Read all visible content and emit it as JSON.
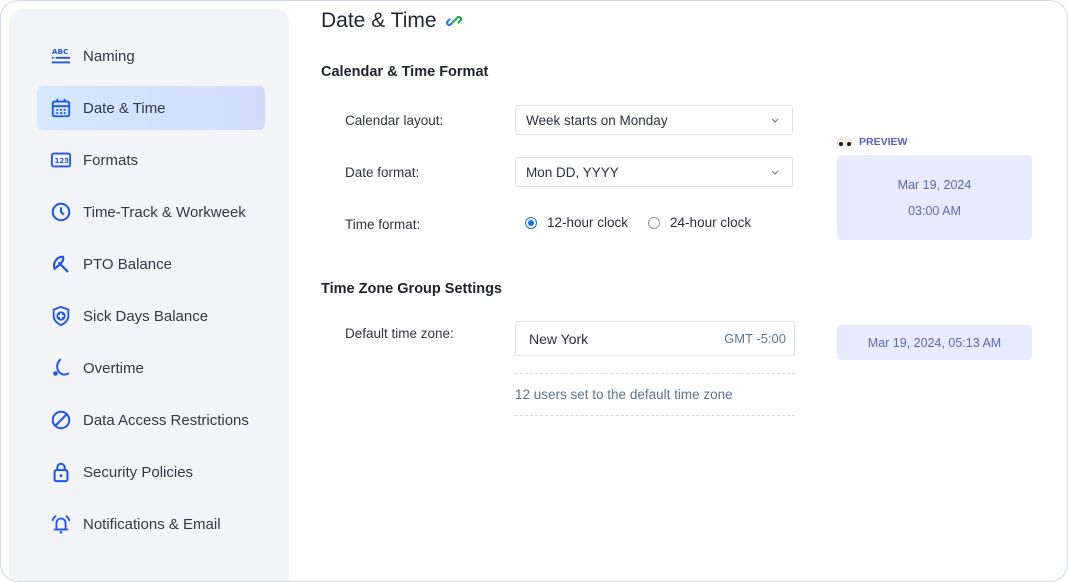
{
  "sidebar": {
    "items": [
      {
        "label": "Naming",
        "icon": "abc-list-icon",
        "active": false
      },
      {
        "label": "Date & Time",
        "icon": "calendar-icon",
        "active": true
      },
      {
        "label": "Formats",
        "icon": "numbers-123-icon",
        "active": false
      },
      {
        "label": "Time-Track & Workweek",
        "icon": "clock-icon",
        "active": false
      },
      {
        "label": "PTO Balance",
        "icon": "beach-umbrella-icon",
        "active": false
      },
      {
        "label": "Sick Days Balance",
        "icon": "shield-plus-icon",
        "active": false
      },
      {
        "label": "Overtime",
        "icon": "moon-icon",
        "active": false
      },
      {
        "label": "Data Access Restrictions",
        "icon": "prohibited-icon",
        "active": false
      },
      {
        "label": "Security Policies",
        "icon": "lock-icon",
        "active": false
      },
      {
        "label": "Notifications & Email",
        "icon": "bell-ringing-icon",
        "active": false
      }
    ]
  },
  "main": {
    "title": "Date & Time",
    "title_icon": "link-icon",
    "calendar_section": {
      "title": "Calendar & Time Format",
      "calendar_layout_label": "Calendar layout:",
      "calendar_layout_value": "Week starts on Monday",
      "date_format_label": "Date format:",
      "date_format_value": "Mon DD, YYYY",
      "time_format_label": "Time format:",
      "time_options": [
        {
          "label": "12-hour clock",
          "checked": true
        },
        {
          "label": "24-hour clock",
          "checked": false
        }
      ]
    },
    "preview": {
      "label": "PREVIEW",
      "icon": "eyes-icon",
      "date": "Mar 19, 2024",
      "time": "03:00 AM"
    },
    "timezone_section": {
      "title": "Time Zone Group Settings",
      "default_tz_label": "Default time zone:",
      "tz_city": "New York",
      "tz_offset": "GMT -5:00",
      "users_note": "12 users set to the default time zone",
      "tz_preview": "Mar 19, 2024, 05:13 AM"
    }
  },
  "colors": {
    "accent": "#1a56f0",
    "active_bg_start": "#d5e8ff",
    "active_bg_end": "#d2dafc",
    "preview_bg": "#e8ebfd",
    "preview_text": "#5d66b5"
  }
}
